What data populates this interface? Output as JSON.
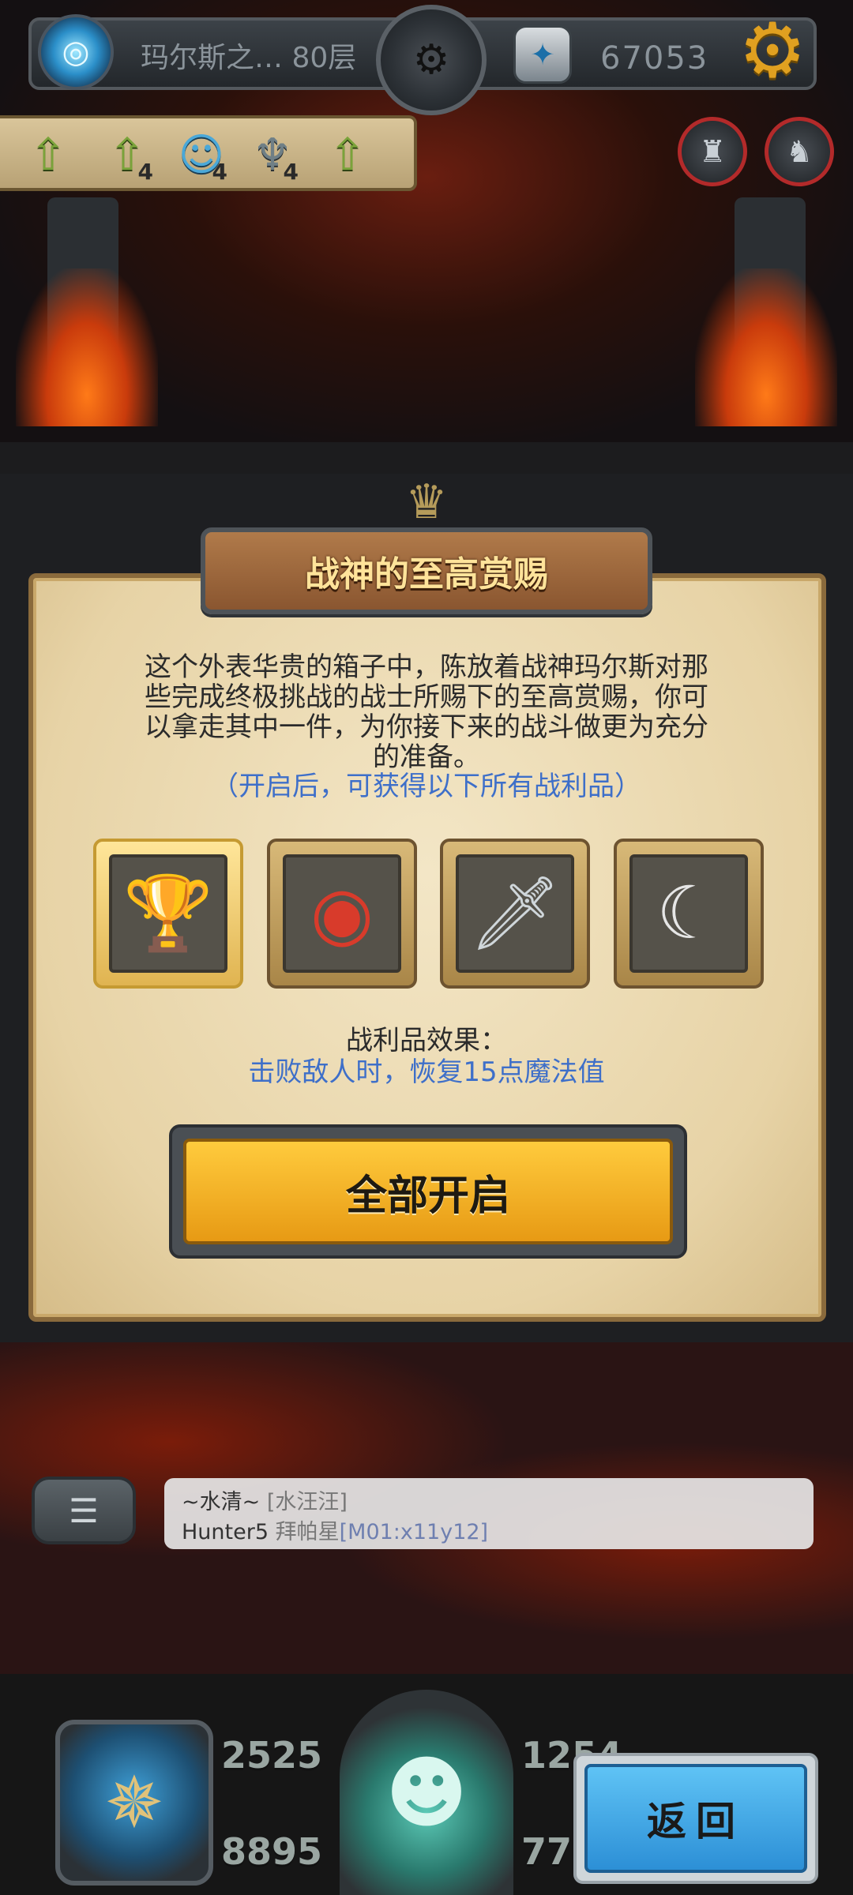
{
  "topbar": {
    "floor_label": "玛尔斯之… 80层",
    "gold_amount": "67053"
  },
  "buffs": [
    {
      "icon": "up-arrow-icon",
      "count": ""
    },
    {
      "icon": "up-arrow-icon",
      "count": "4"
    },
    {
      "icon": "companion-icon",
      "count": "4"
    },
    {
      "icon": "wings-icon",
      "count": "4"
    },
    {
      "icon": "up-arrow-icon",
      "count": ""
    }
  ],
  "dialog": {
    "title": "战神的至高赏赐",
    "description": "这个外表华贵的箱子中，陈放着战神玛尔斯对那些完成终极挑战的战士所赐下的至高赏赐，你可以拿走其中一件，为你接下来的战斗做更为充分的准备。",
    "note": "（开启后，可获得以下所有战利品）",
    "loot": [
      {
        "icon": "chalice-icon",
        "selected": true
      },
      {
        "icon": "ruby-amulet-icon",
        "selected": false
      },
      {
        "icon": "dagger-icon",
        "selected": false
      },
      {
        "icon": "curved-blade-icon",
        "selected": false
      }
    ],
    "effect_label": "战利品效果：",
    "effect_text": "击败敌人时，恢复15点魔法值",
    "open_all_label": "全部开启"
  },
  "chat": {
    "line1_name": "~水清~",
    "line1_tag": "[水汪汪]",
    "line2_name": "Hunter5",
    "line2_text": "拜帕星",
    "line2_link": "[M01:x11y12]"
  },
  "hud": {
    "stat_attack": "2525",
    "stat_hp": "8895",
    "stat_defense": "1254",
    "stat_gold": "77",
    "back_label": "返回"
  },
  "colors": {
    "accent_blue_text": "#3e6fc9",
    "gold_button": "#f0b12a",
    "blue_button": "#3aa6e8",
    "parchment": "#ecdcb4"
  }
}
